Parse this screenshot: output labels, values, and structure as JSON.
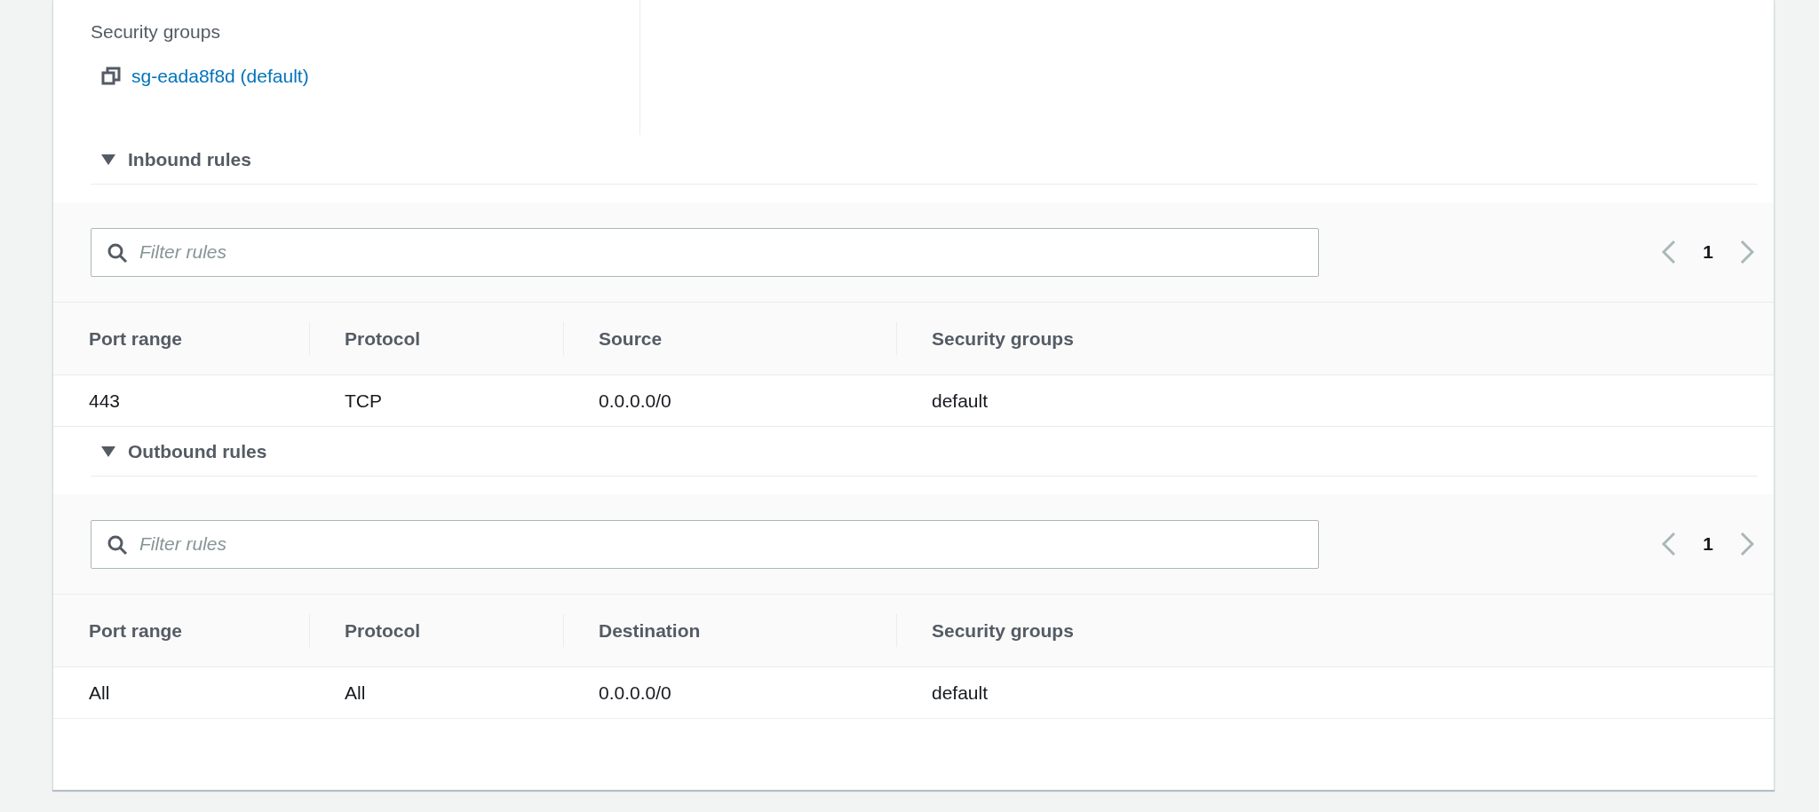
{
  "security_groups": {
    "label": "Security groups",
    "items": [
      {
        "name": "sg-eada8f8d (default)"
      }
    ]
  },
  "rule_sections": [
    {
      "title": "Inbound rules",
      "expanded": true,
      "filter": {
        "placeholder": "Filter rules"
      },
      "pagination": {
        "page": "1"
      },
      "columns": [
        "Port range",
        "Protocol",
        "Source",
        "Security groups"
      ],
      "rows": [
        [
          "443",
          "TCP",
          "0.0.0.0/0",
          "default"
        ]
      ]
    },
    {
      "title": "Outbound rules",
      "expanded": true,
      "filter": {
        "placeholder": "Filter rules"
      },
      "pagination": {
        "page": "1"
      },
      "columns": [
        "Port range",
        "Protocol",
        "Destination",
        "Security groups"
      ],
      "rows": [
        [
          "All",
          "All",
          "0.0.0.0/0",
          "default"
        ]
      ]
    }
  ]
}
